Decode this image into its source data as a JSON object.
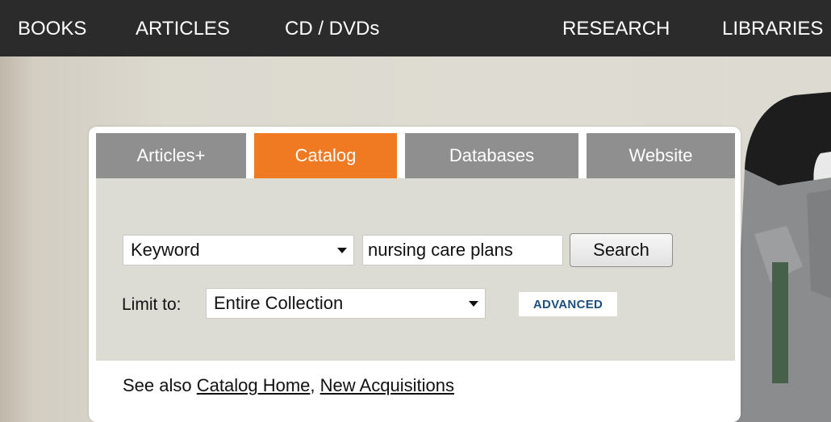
{
  "topnav": {
    "items": [
      "BOOKS",
      "ARTICLES",
      "CD / DVDs",
      "RESEARCH",
      "LIBRARIES"
    ]
  },
  "search_widget": {
    "tabs": [
      {
        "label": "Articles+",
        "active": false
      },
      {
        "label": "Catalog",
        "active": true
      },
      {
        "label": "Databases",
        "active": false
      },
      {
        "label": "Website",
        "active": false
      }
    ],
    "search_type": {
      "selected": "Keyword"
    },
    "query": {
      "value": "nursing care plans"
    },
    "search_button_label": "Search",
    "limit": {
      "label": "Limit to:",
      "selected": "Entire Collection"
    },
    "advanced_label": "ADVANCED",
    "see_also": {
      "prefix": "See also",
      "links": [
        "Catalog Home",
        "New Acquisitions"
      ],
      "separator": ","
    }
  },
  "colors": {
    "nav_bg": "#2b2b2b",
    "tab_active": "#f07a22",
    "tab_inactive": "#8f8f8f",
    "panel_bg": "#dcdcd5",
    "advanced_text": "#1d4f7d"
  }
}
